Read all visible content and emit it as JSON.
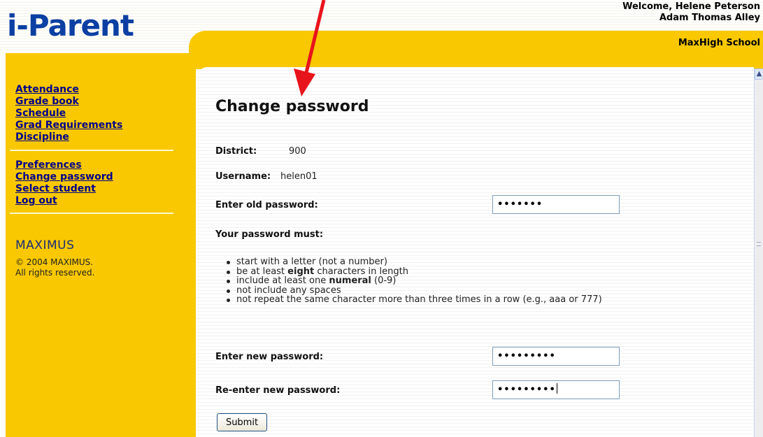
{
  "app": {
    "logo": "i-Parent"
  },
  "header": {
    "welcome": "Welcome, Helene Peterson",
    "student": "Adam Thomas Alley",
    "school": "MaxHigh School"
  },
  "sidebar": {
    "primary": [
      {
        "label": "Attendance"
      },
      {
        "label": "Grade book"
      },
      {
        "label": "Schedule"
      },
      {
        "label": "Grad Requirements"
      },
      {
        "label": "Discipline"
      }
    ],
    "secondary": [
      {
        "label": "Preferences"
      },
      {
        "label": "Change password"
      },
      {
        "label": "Select student"
      },
      {
        "label": "Log out"
      }
    ],
    "brand": "MAXIMUS",
    "copyright_line1": "© 2004 MAXIMUS.",
    "copyright_line2": "All rights reserved."
  },
  "main": {
    "title": "Change password",
    "district_label": "District:",
    "district_value": "900",
    "username_label": "Username:",
    "username_value": "helen01",
    "old_password_label": "Enter old password:",
    "old_password_value": "•••••••",
    "rules_heading": "Your password must:",
    "rules": [
      {
        "pre": "start with a letter (not a number)",
        "bold": "",
        "post": ""
      },
      {
        "pre": "be at least ",
        "bold": "eight",
        "post": " characters in length"
      },
      {
        "pre": "include at least one ",
        "bold": "numeral",
        "post": " (0-9)"
      },
      {
        "pre": "not include any spaces",
        "bold": "",
        "post": ""
      },
      {
        "pre": "not repeat the same character more than three times in a row (e.g., aaa or 777)",
        "bold": "",
        "post": ""
      }
    ],
    "new_password_label": "Enter new password:",
    "new_password_value": "•••••••••",
    "reenter_password_label": "Re-enter new password:",
    "reenter_password_value": "•••••••••",
    "submit_label": "Submit"
  },
  "annotation": {
    "arrow_color": "#e8141c"
  },
  "colors": {
    "brand_yellow": "#f9c800",
    "logo_blue": "#0b3fa3",
    "link_navy": "#00008b"
  }
}
